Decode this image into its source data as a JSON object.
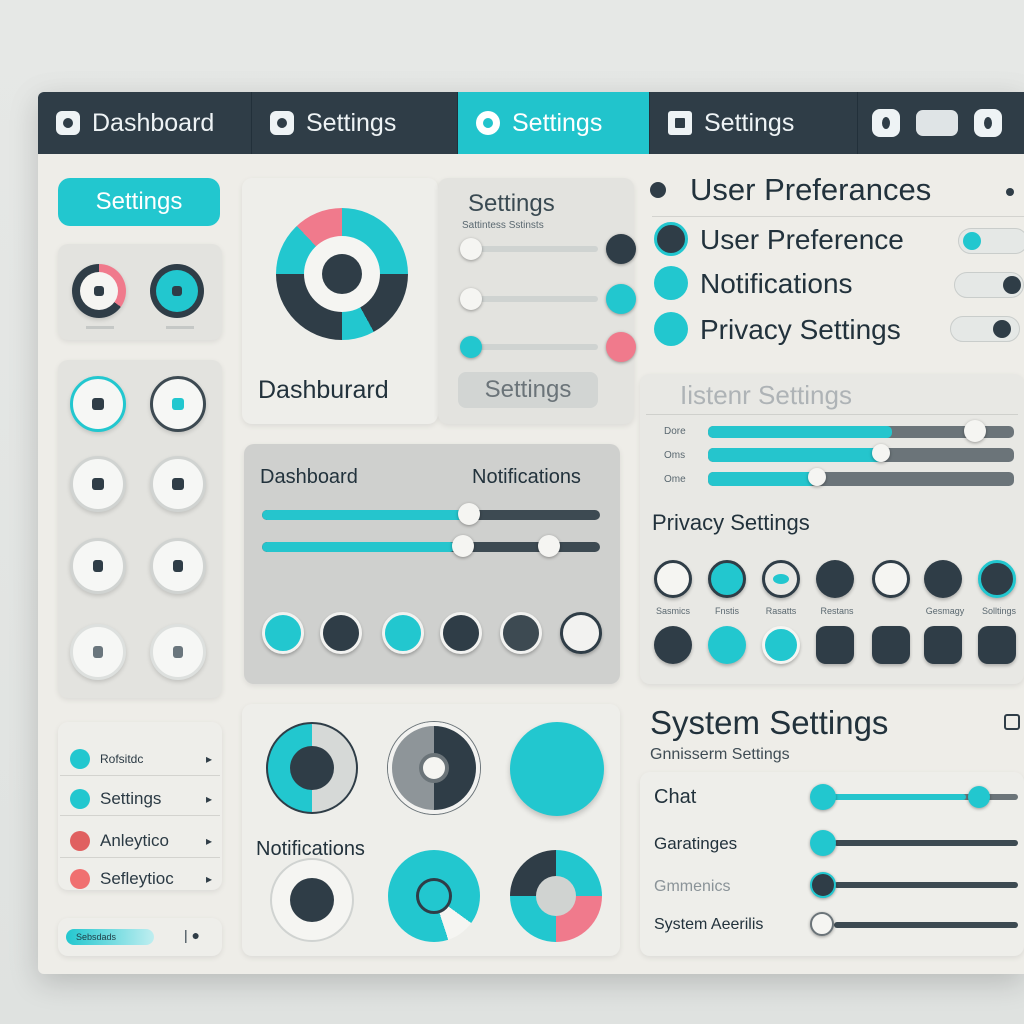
{
  "tabs": [
    {
      "label": "Dashboard",
      "active": false
    },
    {
      "label": "Settings",
      "active": false
    },
    {
      "label": "Settings",
      "active": true
    },
    {
      "label": "Settings",
      "active": false
    }
  ],
  "sidebar": {
    "chip_label": "Settings",
    "list": [
      {
        "label": "Rofsitdc",
        "color": "#22c7cf"
      },
      {
        "label": "Settings",
        "color": "#22c7cf"
      },
      {
        "label": "Anleytico",
        "color": "#e06060"
      },
      {
        "label": "Sefleytioc",
        "color": "#f07070"
      }
    ],
    "footer_bar": "Sebsdads"
  },
  "dashboard_card": {
    "title": "Dashburard"
  },
  "settings_card": {
    "title": "Settings",
    "subtitle": "Sattintess Sstinsts",
    "button_label": "Settings"
  },
  "sliders_card": {
    "left_title": "Dashboard",
    "right_title": "Notifications",
    "levels": [
      0.55,
      0.5
    ]
  },
  "knobs_card": {
    "label": "Notifications"
  },
  "user_prefs": {
    "heading": "User Preferances",
    "items": [
      "User Preference",
      "Notifications",
      "Privacy Settings"
    ]
  },
  "system_block": {
    "heading_faded": "Iistenr Settings",
    "rows": [
      "Dore",
      "Oms",
      "Ome"
    ],
    "levels": [
      0.7,
      0.45,
      0.28
    ],
    "privacy_heading": "Privacy Settings",
    "icon_labels": [
      "Sasmics",
      "Fnstis",
      "Rasatts",
      "Restans",
      "Gesmagy",
      "Solltings"
    ]
  },
  "system_settings": {
    "heading": "System Settings",
    "subheading": "Gnnisserm Settings",
    "rows": [
      {
        "label": "Chat",
        "level": 0.85
      },
      {
        "label": "Garatinges",
        "level": 0.0
      },
      {
        "label": "Gmmenics",
        "level": 0.0
      },
      {
        "label": "System Aeerilis",
        "level": 0.0
      }
    ]
  },
  "colors": {
    "accent": "#22c7cf",
    "dark": "#2f3d47",
    "pink": "#f07a8c",
    "bg": "#eeede8"
  }
}
